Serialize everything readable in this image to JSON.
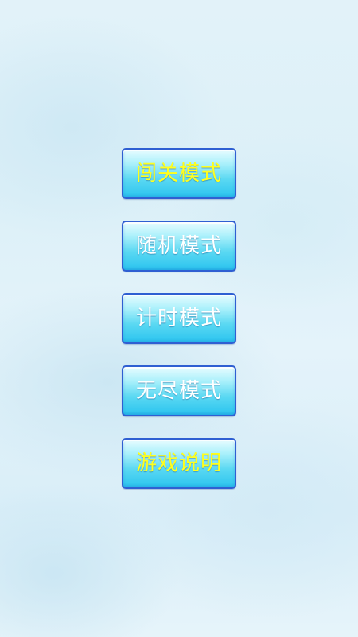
{
  "menu": {
    "buttons": [
      {
        "label": "闯关模式",
        "color": "#ffff1e"
      },
      {
        "label": "随机模式",
        "color": "#ffffff"
      },
      {
        "label": "计时模式",
        "color": "#ffffff"
      },
      {
        "label": "无尽模式",
        "color": "#ffffff"
      },
      {
        "label": "游戏说明",
        "color": "#ffff1e"
      }
    ]
  }
}
